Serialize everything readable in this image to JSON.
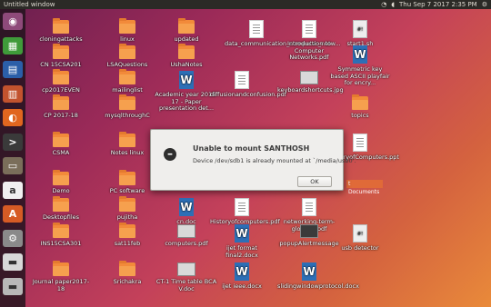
{
  "topbar": {
    "window_title": "Untitled window",
    "datetime": "Thu Sep 7 2017 2:35 PM"
  },
  "launcher": [
    {
      "name": "ubuntu-home",
      "color": "#8e4a7a",
      "glyph": "◉"
    },
    {
      "name": "spreadsheet",
      "color": "#3f9b3a",
      "glyph": "▦"
    },
    {
      "name": "writer",
      "color": "#2b5fa8",
      "glyph": "▤"
    },
    {
      "name": "impress",
      "color": "#c2532e",
      "glyph": "▥"
    },
    {
      "name": "firefox",
      "color": "#e0661f",
      "glyph": "◐"
    },
    {
      "name": "terminal",
      "color": "#3a3a3a",
      "glyph": ">"
    },
    {
      "name": "files",
      "color": "#7a6e5a",
      "glyph": "▭"
    },
    {
      "name": "amazon",
      "color": "#f0f0f0",
      "glyph": "a"
    },
    {
      "name": "software-center",
      "color": "#d65b25",
      "glyph": "A"
    },
    {
      "name": "settings",
      "color": "#8a8a8a",
      "glyph": "⚙"
    },
    {
      "name": "drive",
      "color": "#d8d8d8",
      "glyph": "▬"
    },
    {
      "name": "trash",
      "color": "#b8b8b8",
      "glyph": "▬"
    }
  ],
  "desktop": [
    {
      "label": "cloningattacks",
      "type": "folder"
    },
    {
      "label": "linux",
      "type": "folder"
    },
    {
      "label": "updated",
      "type": "folder"
    },
    {
      "label": "data_communication_computer_netw...",
      "type": "pdf"
    },
    {
      "label": "Introduction to Computer Networks.pdf",
      "type": "pdf"
    },
    {
      "label": "start1.sh",
      "type": "script"
    },
    {
      "label": "CN 15CSA201",
      "type": "folder"
    },
    {
      "label": "LSAQuestions",
      "type": "folder"
    },
    {
      "label": "UshaNotes",
      "type": "folder"
    },
    {
      "label": "Symmetric key based ASCII playfair for encry...",
      "type": "word"
    },
    {
      "label": "cp2017EVEN",
      "type": "folder"
    },
    {
      "label": "mailinglist",
      "type": "folder"
    },
    {
      "label": "Academic year 2016-17 - Paper presentation det...",
      "type": "word"
    },
    {
      "label": "diffusionandconfusion.pdf",
      "type": "pdf"
    },
    {
      "label": "keyboardshortcuts.jpg",
      "type": "image"
    },
    {
      "label": "CP 2017-18",
      "type": "folder"
    },
    {
      "label": "mysqlthroughC",
      "type": "folder"
    },
    {
      "label": "topics",
      "type": "folder"
    },
    {
      "label": "CSMA",
      "type": "folder"
    },
    {
      "label": "Notes linux",
      "type": "folder"
    },
    {
      "label": "HistoryofComputers.ppt",
      "type": "pdf"
    },
    {
      "label": "Demo",
      "type": "folder"
    },
    {
      "label": "PC software",
      "type": "folder"
    },
    {
      "label": "Desktopfiles",
      "type": "folder"
    },
    {
      "label": "pujitha",
      "type": "folder"
    },
    {
      "label": "cn.doc",
      "type": "word"
    },
    {
      "label": "Historyofcomputers.pdf",
      "type": "pdf"
    },
    {
      "label": "networking-term-glossary.pdf",
      "type": "pdf"
    },
    {
      "label": "INS15CSA301",
      "type": "folder"
    },
    {
      "label": "sat11feb",
      "type": "folder"
    },
    {
      "label": "computers.pdf",
      "type": "image"
    },
    {
      "label": "ijet format final2.docx",
      "type": "word"
    },
    {
      "label": "popupAlertmessage",
      "type": "image-dark"
    },
    {
      "label": "usb detector",
      "type": "script"
    },
    {
      "label": "Journal paper2017-18",
      "type": "folder"
    },
    {
      "label": "Srichakra",
      "type": "folder"
    },
    {
      "label": "CT-1 Time table BCA V.doc",
      "type": "image"
    },
    {
      "label": "ijet ieee.docx",
      "type": "word"
    },
    {
      "label": "slidingwindowprotocol.docx",
      "type": "word"
    }
  ],
  "dialog": {
    "title": "Unable to mount SANTHOSH",
    "message": "Device /dev/sdb1 is already mounted at `/media/usb0'.",
    "ok_label": "OK",
    "icon": "minus-circle-icon"
  },
  "behind_label": "t Documents"
}
